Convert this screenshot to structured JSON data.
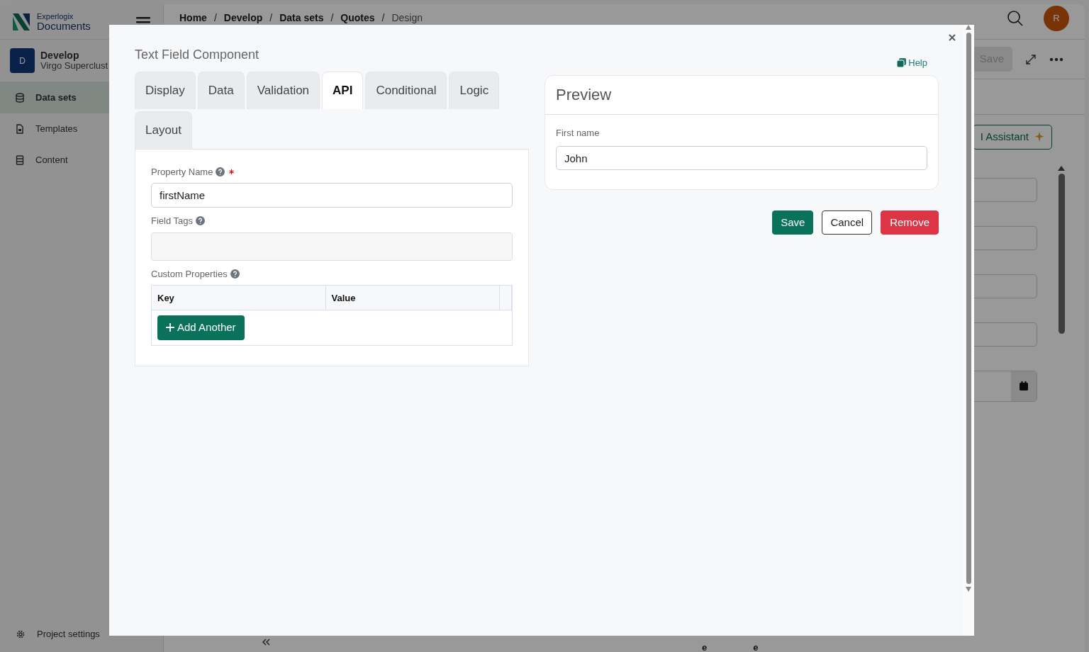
{
  "app": {
    "brand_small": "Experlogix",
    "brand": "Documents",
    "workspace": {
      "initial": "D",
      "name": "Develop",
      "subtitle": "Virgo Superclust"
    },
    "nav": [
      {
        "label": "Data sets",
        "selected": true
      },
      {
        "label": "Templates",
        "selected": false
      },
      {
        "label": "Content",
        "selected": false
      }
    ],
    "settings": "Project settings",
    "breadcrumb": {
      "separator": "/",
      "items": [
        "Home",
        "Develop",
        "Data sets",
        "Quotes",
        "Design"
      ]
    },
    "avatar": "R",
    "toolbar_save": "Save",
    "assistant": "I Assistant",
    "bottom_cells": [
      "e",
      "e"
    ]
  },
  "modal": {
    "title": "Text Field Component",
    "help": "Help",
    "tabs": [
      {
        "label": "Display",
        "selected": false
      },
      {
        "label": "Data",
        "selected": false
      },
      {
        "label": "Validation",
        "selected": false
      },
      {
        "label": "API",
        "selected": true
      },
      {
        "label": "Conditional",
        "selected": false
      },
      {
        "label": "Logic",
        "selected": false
      },
      {
        "label": "Layout",
        "selected": false
      }
    ],
    "fields": [
      {
        "kind": "text",
        "label": "Property Name",
        "help": true,
        "required": true,
        "value": "firstName"
      },
      {
        "kind": "tags",
        "label": "Field Tags",
        "help": true,
        "required": false
      },
      {
        "kind": "table",
        "label": "Custom Properties",
        "help": true,
        "required": false,
        "columns": [
          "Key",
          "Value"
        ],
        "add_button": "Add Another"
      }
    ],
    "preview": {
      "title": "Preview",
      "label": "First name",
      "value": "John"
    },
    "buttons": [
      {
        "label": "Save",
        "kind": "success"
      },
      {
        "label": "Cancel",
        "kind": "outline"
      },
      {
        "label": "Remove",
        "kind": "danger"
      }
    ]
  }
}
